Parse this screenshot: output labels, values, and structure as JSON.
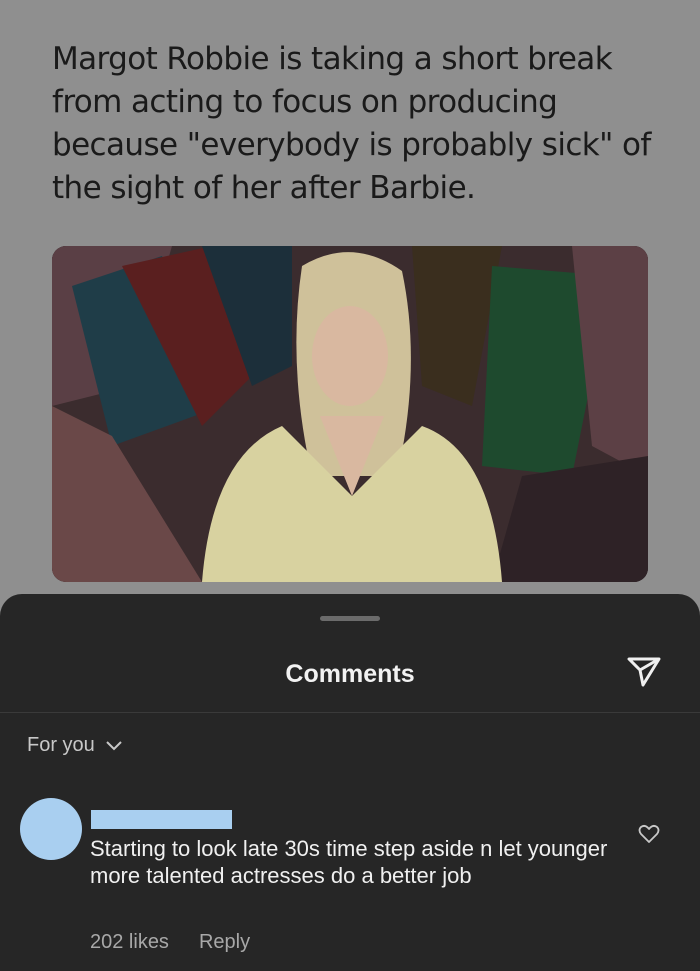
{
  "post": {
    "text": "Margot Robbie is taking a short break from acting to focus on producing because \"everybody is probably sick\" of the sight of her after Barbie."
  },
  "comments_sheet": {
    "title": "Comments",
    "share_icon": "send-icon",
    "filter_label": "For you",
    "filter_icon": "chevron-down-icon"
  },
  "comment": {
    "text": "Starting to look late 30s time step aside n let younger more talented actresses do a better job",
    "likes": "202 likes",
    "reply_label": "Reply",
    "like_icon": "heart-icon",
    "avatar_color": "#a9cff0"
  },
  "colors": {
    "overlay": "#8f8f8f",
    "sheet": "#262626"
  }
}
